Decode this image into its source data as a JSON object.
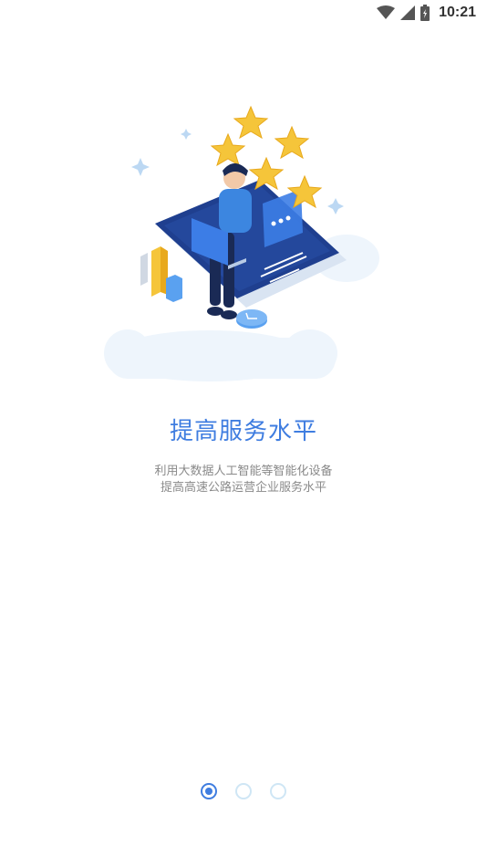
{
  "status_bar": {
    "time": "10:21",
    "icons": [
      "wifi-icon",
      "cell-signal-icon",
      "battery-icon"
    ]
  },
  "onboarding": {
    "title": "提高服务水平",
    "subtitle_lines": [
      "利用大数据人工智能等智能化设备",
      "提高高速公路运营企业服务水平"
    ],
    "pages": 3,
    "active_page": 1
  },
  "colors": {
    "accent": "#3f7de0",
    "subtitle": "#8a8a8a",
    "dot_inactive": "#cfe6f5",
    "star": "#f5c53a",
    "phone": "#1f3f8f"
  }
}
